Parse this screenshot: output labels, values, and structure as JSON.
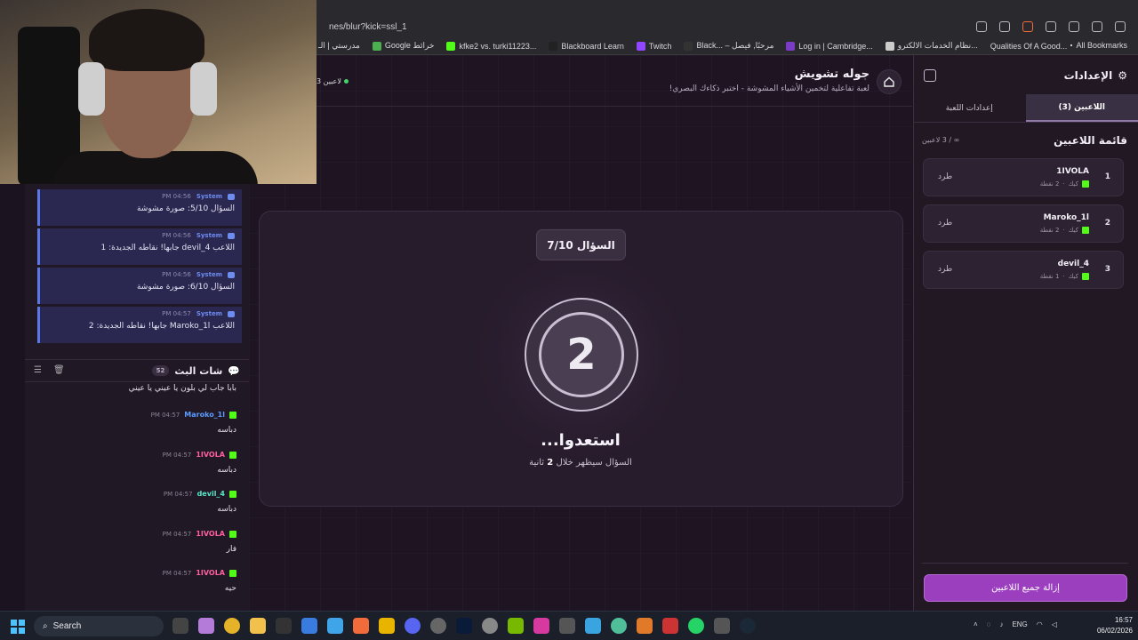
{
  "browser": {
    "url": "nes/blur?kick=ssl_1",
    "bookmarks": [
      "مدرستي | الـ",
      "Google خرائط",
      "kfke2 vs. turki11223...",
      "Blackboard Learn",
      "Twitch",
      "Black... – مرحبًا, فيصل",
      "Log in | Cambridge...",
      "نظام الخدمات الالكترو...",
      "Qualities Of A Good..."
    ],
    "all_bookmarks": "All Bookmarks"
  },
  "chat_panel": {
    "system_messages": [
      {
        "sender": "System",
        "time": "PM 04:56",
        "text": "السؤال 5/10: صورة مشوشة"
      },
      {
        "sender": "System",
        "time": "PM 04:56",
        "text": "اللاعب devil_4 جابها! نقاطه الجديدة: 1"
      },
      {
        "sender": "System",
        "time": "PM 04:56",
        "text": "السؤال 6/10: صورة مشوشة"
      },
      {
        "sender": "System",
        "time": "PM 04:57",
        "text": "اللاعب Maroko_1l جابها! نقاطه الجديدة: 2"
      }
    ],
    "title": "شات البث",
    "count": "52",
    "first_line": "بابا جاب لي بلون يا عيني يا عيني",
    "messages": [
      {
        "user": "Maroko_1l",
        "time": "PM 04:57",
        "text": "دباسه",
        "color": "#5b9bff"
      },
      {
        "user": "1IVOLA",
        "time": "PM 04:57",
        "text": "دباسه",
        "color": "#ff5fa0"
      },
      {
        "user": "devil_4",
        "time": "PM 04:57",
        "text": "دباسه",
        "color": "#58e6c8"
      },
      {
        "user": "1IVOLA",
        "time": "PM 04:57",
        "text": "فار",
        "color": "#ff5fa0"
      },
      {
        "user": "1IVOLA",
        "time": "PM 04:57",
        "text": "حيه",
        "color": "#ff5fa0"
      }
    ]
  },
  "game": {
    "title": "جوله تشويش",
    "subtitle": "لعبة تفاعلية لتخمين الأشياء المشوشة - اختبر ذكاءك البصري!",
    "online": "3 لاعبين",
    "question": "السؤال 7/10",
    "countdown": "2",
    "ready": "استعدوا...",
    "ready_sub_pre": "السؤال سيظهر خلال",
    "ready_sub_num": "2",
    "ready_sub_post": "ثانية"
  },
  "sidebar": {
    "title": "الإعدادات",
    "tabs": [
      {
        "label": "اللاعبين (3)",
        "active": true
      },
      {
        "label": "إعدادات اللعبة",
        "active": false
      }
    ],
    "list_title": "قائمة اللاعبين",
    "list_count": "∞ / 3 لاعبين",
    "players": [
      {
        "rank": "1",
        "name": "1IVOLA",
        "platform": "كيك",
        "points": "2 نقطة",
        "kick": "طرد"
      },
      {
        "rank": "2",
        "name": "Maroko_1l",
        "platform": "كيك",
        "points": "2 نقطة",
        "kick": "طرد"
      },
      {
        "rank": "3",
        "name": "devil_4",
        "platform": "كيك",
        "points": "1 نقطة",
        "kick": "طرد"
      }
    ],
    "clear_all": "إزالة جميع اللاعبين"
  },
  "taskbar": {
    "search": "Search",
    "lang": "ENG",
    "time": "16:57",
    "date": "06/02/2026"
  }
}
